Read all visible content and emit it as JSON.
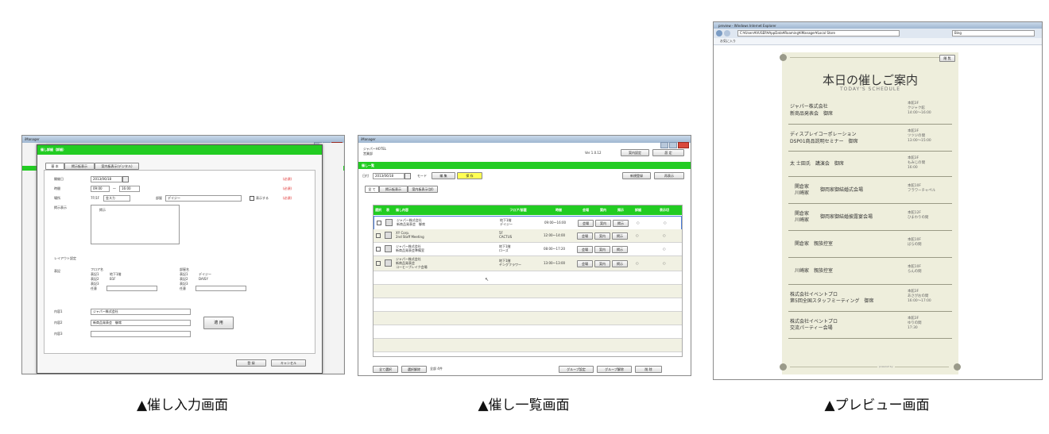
{
  "captions": {
    "input": "▲催し入力画面",
    "list": "▲催し一覧画面",
    "preview": "▲プレビュー画面"
  },
  "input_screen": {
    "window_title": "iManager",
    "dialog_title": "催し詳細（詳細）",
    "tabs": [
      "基 本",
      "掲示板表示",
      "案内板表示(デジタル)"
    ],
    "fields": {
      "date_label": "開催日",
      "date_value": "2013/06/18",
      "time_label": "時間",
      "time_from": "09:00",
      "time_sep": "〜",
      "time_to": "16:00",
      "place_label": "場所",
      "place_floor": "7F/1F",
      "place_room": "金スカ",
      "venue_label": "部屋",
      "venue_value": "デイジー",
      "display_check": "表示する",
      "required1": "(必須)",
      "required2": "(必須)",
      "required3": "(必須)",
      "display_label": "掲示表示",
      "display_check_item": "掲示",
      "layout_label": "レイアウト設定",
      "layout_display_label": "表記",
      "floor_col": "フロア名",
      "room_col": "部屋名",
      "floor_opts": [
        "表記1",
        "表記2",
        "表記3",
        "任意"
      ],
      "floor_vals": [
        "地下1階",
        "B1F"
      ],
      "room_opts": [
        "表記1",
        "表記2",
        "表記3",
        "任意"
      ],
      "room_vals": [
        "デイジー",
        "DAISY"
      ],
      "content1_label": "内容1",
      "content1_value": "ジャパー株式会社",
      "content2_label": "内容2",
      "content2_value": "新商品発表会　御席",
      "content3_label": "内容3",
      "content3_value": ""
    },
    "apply_button": "適 用",
    "ok_button": "登 録",
    "cancel_button": "キャンセル"
  },
  "list_screen": {
    "window_title": "iManager",
    "hotel_name": "ジャパーHOTEL",
    "subtitle": "営業部",
    "version": "Ver 1.0.12",
    "btn_guide": "案内設定",
    "btn_settings": "設 定",
    "green_header": "催し一覧",
    "date_label": "日付",
    "date_value": "2013/06/18",
    "mode_label": "モード",
    "mode_value": "編 集",
    "mode_badge": "保 存",
    "btn_register": "新規登録",
    "btn_preview": "再表示",
    "tabs": [
      "全 て",
      "掲示板表示",
      "案内板表示(詳)"
    ],
    "columns": [
      "選択",
      "表",
      "催し内容",
      "フロア/部屋",
      "時間",
      "会場",
      "案内",
      "掲示",
      "詳細",
      "表示切"
    ],
    "rows": [
      {
        "title1": "ジャパー株式会社",
        "title2": "新商品発表会　御席",
        "room1": "地下1階",
        "room2": "デイジー",
        "time": "09:00〜16:00",
        "m1": "○",
        "m2": "○"
      },
      {
        "title1": "XY Corp.",
        "title2": "2nd Staff Meeting",
        "room1": "5F",
        "room2": "CACTUS",
        "time": "12:00〜14:00",
        "m1": "○",
        "m2": "○"
      },
      {
        "title1": "ジャパー株式会社",
        "title2": "新商品発表会準備室",
        "room1": "地下1階",
        "room2": "ローズ",
        "time": "08:00〜17:20",
        "m1": "",
        "m2": "○"
      },
      {
        "title1": "ジャパー株式会社",
        "title2": "新商品発表会",
        "title3": "コーヒーブレイク会場",
        "room1": "地下1階",
        "room2": "ヤングフラワー",
        "time": "13:00〜13:00",
        "m1": "○",
        "m2": "○"
      }
    ],
    "row_buttons": [
      "会場",
      "案内",
      "掲示"
    ],
    "btn_select_all": "全て選択",
    "btn_deselect": "選択解除",
    "count_label": "全部 4件",
    "btn_group_set": "グループ設定",
    "btn_group_clear": "グループ解除",
    "btn_delete": "削 除"
  },
  "preview_screen": {
    "window_title": "preview - Windows Internet Explorer",
    "address": "C:¥Users¥VUSER¥AppData¥Roaming¥iManager¥Local Store",
    "search_engine": "Bing",
    "favorites": "お気に入り",
    "close_button": "閉 覧",
    "heading": "本日の催しご案内",
    "subheading": "TODAY'S SCHEDULE",
    "footer_tag": "powered by",
    "items": [
      {
        "name1": "ジャパー株式会社",
        "name2": "新商品発表会　御席",
        "room1": "本館3F",
        "room2": "クジャク館",
        "room3": "14:00〜16:00"
      },
      {
        "name1": "ディスプレイコーポレーション",
        "name2": "DSP01商品説明セミナー　御席",
        "room1": "本館3F",
        "room2": "ツツジの間",
        "room3": "13:00〜15:00"
      },
      {
        "name1": "太 士田氏　講演会　御席",
        "name2": "",
        "room1": "本館3F",
        "room2": "もみじの間",
        "room3": "16:00"
      },
      {
        "name1": "関倉家",
        "name1b": "川崎家",
        "name2": "御両家御結婚式会場",
        "room1": "本館10F",
        "room2": "フラワーチャペル",
        "room3": ""
      },
      {
        "name1": "関倉家",
        "name1b": "川崎家",
        "name2": "御両家御結婚披露宴会場",
        "room1": "本館12F",
        "room2": "ひまわりの間",
        "room3": ""
      },
      {
        "name1": "関倉家　親族控室",
        "name2": "",
        "room1": "本館10F",
        "room2": "ばらの間",
        "room3": ""
      },
      {
        "name1": "川崎家　親族控室",
        "name2": "",
        "room1": "本館10F",
        "room2": "らんの間",
        "room3": ""
      },
      {
        "name1": "株式会社イベントプロ",
        "name2": "第5回全国スタッフミーティング　御席",
        "room1": "本館3F",
        "room2": "あさがおの間",
        "room3": "16:00〜17:00"
      },
      {
        "name1": "株式会社イベントプロ",
        "name2": "交流パーティー会場",
        "room1": "本館3F",
        "room2": "ゆりの間",
        "room3": "17:30"
      }
    ]
  },
  "colors": {
    "accent_green": "#22cc22",
    "preview_bg": "#eeeedc",
    "win_title": "#a9bfd8"
  }
}
